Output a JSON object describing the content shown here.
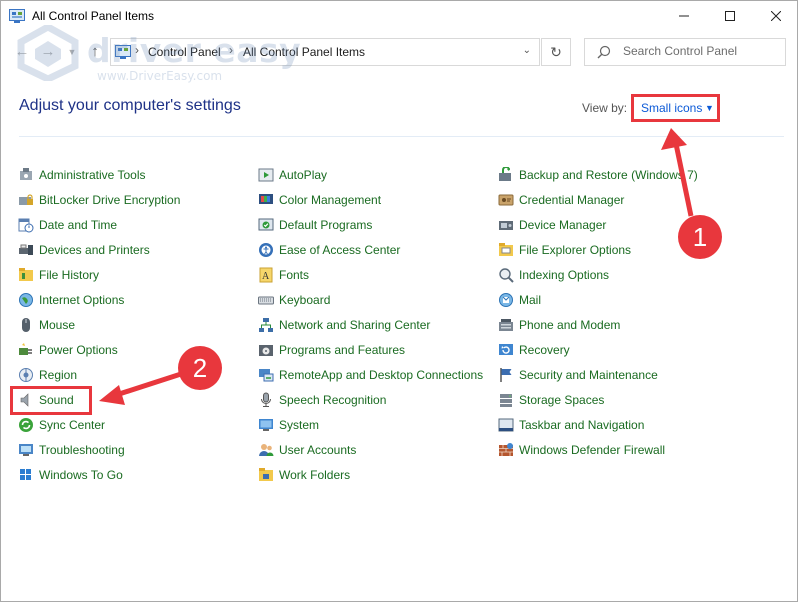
{
  "window": {
    "title": "All Control Panel Items"
  },
  "address": {
    "crumbs": [
      "Control Panel",
      "All Control Panel Items"
    ]
  },
  "search": {
    "placeholder": "Search Control Panel"
  },
  "watermark": {
    "brand": "driver easy",
    "url": "www.DriverEasy.com"
  },
  "page": {
    "heading": "Adjust your computer's settings",
    "view_by_label": "View by:",
    "view_by_value": "Small icons"
  },
  "columns": [
    [
      {
        "label": "Administrative Tools",
        "icon": "admin-tools-icon"
      },
      {
        "label": "BitLocker Drive Encryption",
        "icon": "bitlocker-icon"
      },
      {
        "label": "Date and Time",
        "icon": "clock-icon"
      },
      {
        "label": "Devices and Printers",
        "icon": "printer-icon"
      },
      {
        "label": "File History",
        "icon": "file-history-icon"
      },
      {
        "label": "Internet Options",
        "icon": "globe-icon"
      },
      {
        "label": "Mouse",
        "icon": "mouse-icon"
      },
      {
        "label": "Power Options",
        "icon": "power-icon"
      },
      {
        "label": "Region",
        "icon": "region-icon"
      },
      {
        "label": "Sound",
        "icon": "speaker-icon"
      },
      {
        "label": "Sync Center",
        "icon": "sync-icon"
      },
      {
        "label": "Troubleshooting",
        "icon": "troubleshoot-icon"
      },
      {
        "label": "Windows To Go",
        "icon": "windows-to-go-icon"
      }
    ],
    [
      {
        "label": "AutoPlay",
        "icon": "autoplay-icon"
      },
      {
        "label": "Color Management",
        "icon": "color-icon"
      },
      {
        "label": "Default Programs",
        "icon": "default-programs-icon"
      },
      {
        "label": "Ease of Access Center",
        "icon": "accessibility-icon"
      },
      {
        "label": "Fonts",
        "icon": "fonts-icon"
      },
      {
        "label": "Keyboard",
        "icon": "keyboard-icon"
      },
      {
        "label": "Network and Sharing Center",
        "icon": "network-icon"
      },
      {
        "label": "Programs and Features",
        "icon": "programs-icon"
      },
      {
        "label": "RemoteApp and Desktop Connections",
        "icon": "remoteapp-icon"
      },
      {
        "label": "Speech Recognition",
        "icon": "microphone-icon"
      },
      {
        "label": "System",
        "icon": "system-icon"
      },
      {
        "label": "User Accounts",
        "icon": "users-icon"
      },
      {
        "label": "Work Folders",
        "icon": "work-folders-icon"
      }
    ],
    [
      {
        "label": "Backup and Restore (Windows 7)",
        "icon": "backup-icon"
      },
      {
        "label": "Credential Manager",
        "icon": "credential-icon"
      },
      {
        "label": "Device Manager",
        "icon": "device-manager-icon"
      },
      {
        "label": "File Explorer Options",
        "icon": "folder-options-icon"
      },
      {
        "label": "Indexing Options",
        "icon": "indexing-icon"
      },
      {
        "label": "Mail",
        "icon": "mail-icon"
      },
      {
        "label": "Phone and Modem",
        "icon": "phone-icon"
      },
      {
        "label": "Recovery",
        "icon": "recovery-icon"
      },
      {
        "label": "Security and Maintenance",
        "icon": "flag-icon"
      },
      {
        "label": "Storage Spaces",
        "icon": "storage-icon"
      },
      {
        "label": "Taskbar and Navigation",
        "icon": "taskbar-icon"
      },
      {
        "label": "Windows Defender Firewall",
        "icon": "firewall-icon"
      }
    ]
  ],
  "annotations": {
    "step1": "1",
    "step2": "2"
  },
  "colors": {
    "link": "#1a6b21",
    "heading": "#1e3287",
    "accent": "#0c5ad7",
    "annotation": "#e8373d"
  }
}
